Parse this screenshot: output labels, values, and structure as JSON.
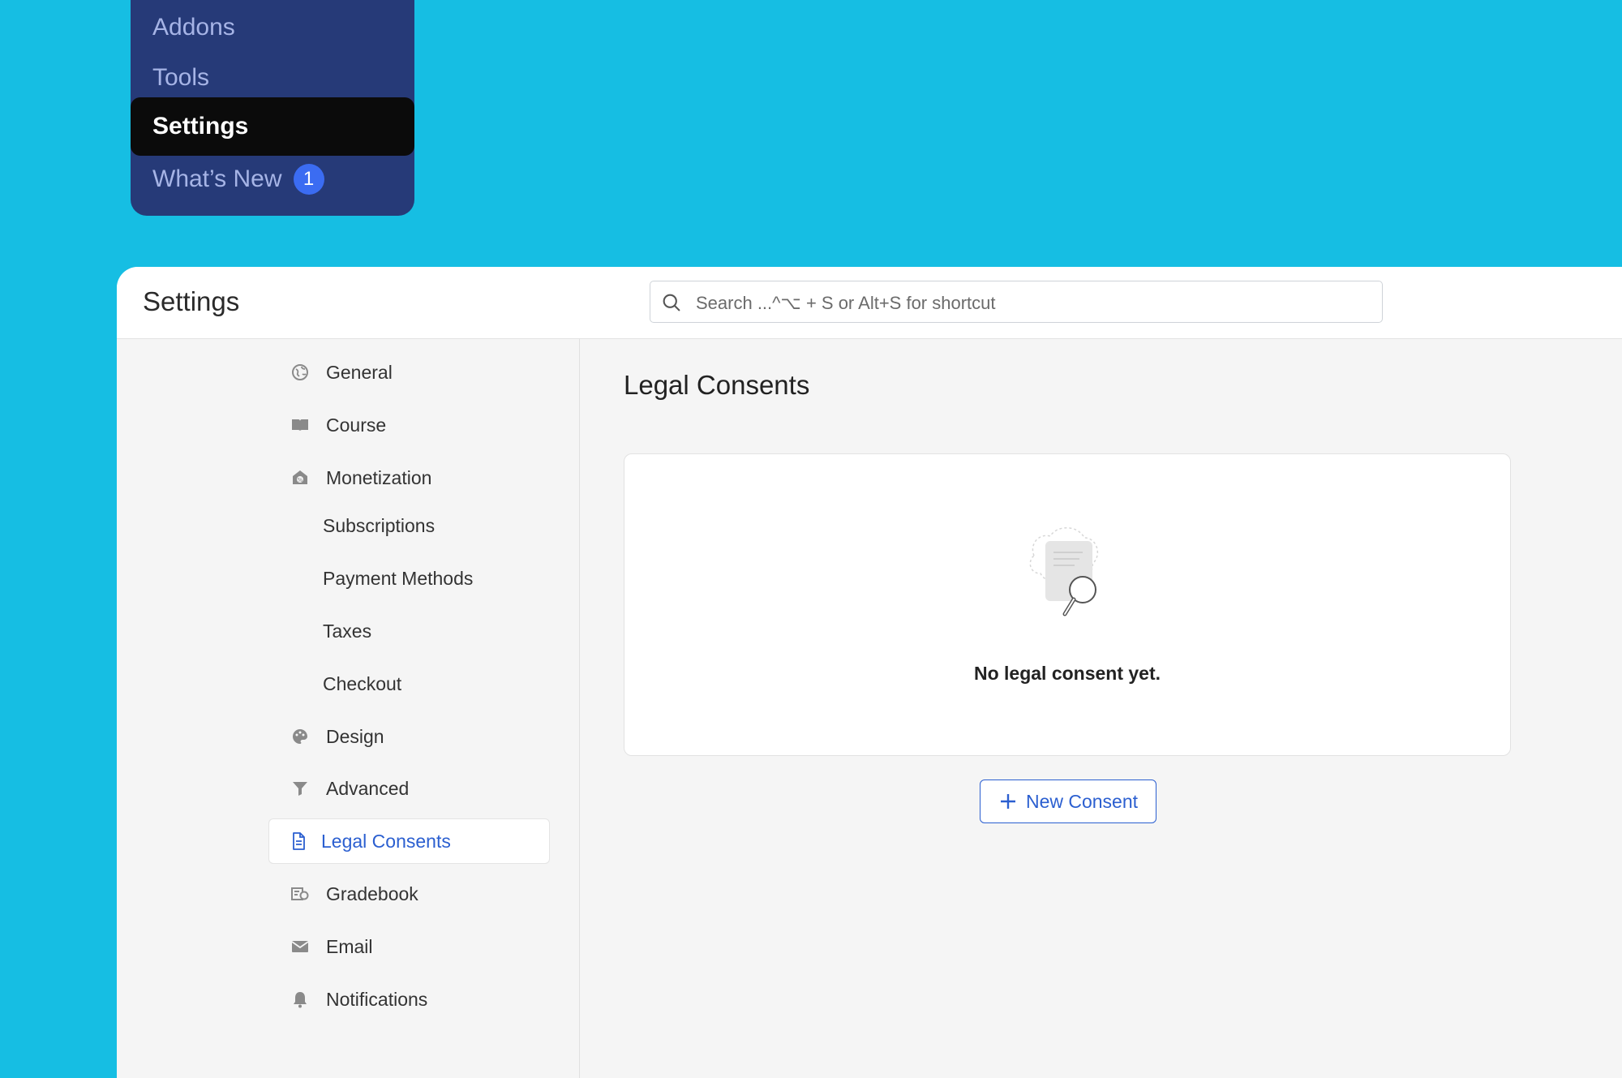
{
  "wp_menu": {
    "items": [
      {
        "label": "Addons"
      },
      {
        "label": "Tools"
      },
      {
        "label": "Settings"
      },
      {
        "label": "What’s New",
        "badge": "1"
      }
    ]
  },
  "header": {
    "title": "Settings",
    "search_placeholder": "Search ...^⌥ + S or Alt+S for shortcut"
  },
  "settings_nav": {
    "items": [
      {
        "label": "General",
        "icon": "globe-icon"
      },
      {
        "label": "Course",
        "icon": "book-icon"
      },
      {
        "label": "Monetization",
        "icon": "monetization-icon"
      },
      {
        "label": "Subscriptions"
      },
      {
        "label": "Payment Methods"
      },
      {
        "label": "Taxes"
      },
      {
        "label": "Checkout"
      },
      {
        "label": "Design",
        "icon": "palette-icon"
      },
      {
        "label": "Advanced",
        "icon": "filter-icon"
      },
      {
        "label": "Legal Consents",
        "icon": "document-icon",
        "active": true
      },
      {
        "label": "Gradebook",
        "icon": "gradebook-icon"
      },
      {
        "label": "Email",
        "icon": "envelope-icon"
      },
      {
        "label": "Notifications",
        "icon": "bell-icon"
      }
    ]
  },
  "content": {
    "title": "Legal Consents",
    "empty_message": "No legal consent yet.",
    "new_button_label": "New Consent"
  },
  "colors": {
    "background": "#16bee3",
    "wp_menu": "#263a78",
    "accent": "#2b5fd0",
    "badge": "#3b6cf2"
  }
}
